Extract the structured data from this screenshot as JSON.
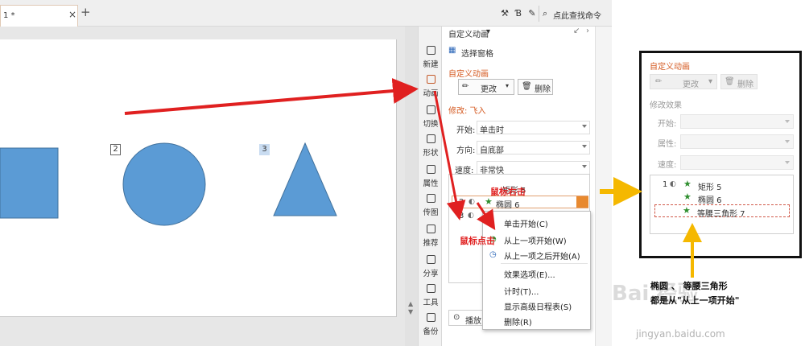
{
  "doc_tab": {
    "title": "1 *",
    "close": "×"
  },
  "new_tab": "+",
  "search": {
    "placeholder": "点此查找命令"
  },
  "slide": {
    "labels": [
      "2",
      "3"
    ]
  },
  "vtoolbar": {
    "items": [
      {
        "label": "新建",
        "icon": "new-slide-icon"
      },
      {
        "label": "动画",
        "icon": "animation-icon"
      },
      {
        "label": "切换",
        "icon": "transition-icon"
      },
      {
        "label": "形状",
        "icon": "shapes-icon"
      },
      {
        "label": "属性",
        "icon": "properties-icon"
      },
      {
        "label": "传图",
        "icon": "upload-image-icon"
      },
      {
        "label": "推荐",
        "icon": "recommend-icon"
      },
      {
        "label": "分享",
        "icon": "share-icon"
      },
      {
        "label": "工具",
        "icon": "tools-icon"
      },
      {
        "label": "备份",
        "icon": "backup-icon"
      }
    ]
  },
  "pane": {
    "header": "自定义动画",
    "header_caret": "▾",
    "select_pane": "选择窗格",
    "section_title": "自定义动画",
    "change_button": "更改",
    "delete_button": "删除",
    "modify_title": "修改: 飞入",
    "start_label": "开始:",
    "start_value": "单击时",
    "direction_label": "方向:",
    "direction_value": "自底部",
    "speed_label": "速度:",
    "speed_value": "非常快",
    "list": [
      {
        "num": "1",
        "text": "矩形 5"
      },
      {
        "num": "2",
        "text": "椭圆 6"
      },
      {
        "num": "3",
        "text": ""
      }
    ],
    "play_button": "播放"
  },
  "annotations": {
    "right_click": "鼠标右击",
    "left_click": "鼠标点击"
  },
  "context_menu": {
    "items": [
      "单击开始(C)",
      "从上一项开始(W)",
      "从上一项之后开始(A)",
      "效果选项(E)...",
      "计时(T)...",
      "显示高级日程表(S)",
      "删除(R)"
    ]
  },
  "callout": {
    "title": "自定义动画",
    "change_button": "更改",
    "delete_button": "删除",
    "modify_title": "修改效果",
    "start_label": "开始:",
    "property_label": "属性:",
    "speed_label": "速度:",
    "list": [
      {
        "num": "1",
        "text": "矩形 5"
      },
      {
        "num": "",
        "text": "椭圆 6"
      },
      {
        "num": "",
        "text": "等腰三角形 7"
      }
    ]
  },
  "caption": {
    "line1": "椭圆 、 等腰三角形",
    "line2": "都是从\"从上一项开始\""
  },
  "watermark": {
    "big": "Bai 经验",
    "small": "jingyan.baidu.com"
  },
  "colors": {
    "shape_fill": "#5b9bd5",
    "arrow_red": "#e02020",
    "arrow_yellow": "#f5b800",
    "accent_orange": "#d4581f"
  }
}
